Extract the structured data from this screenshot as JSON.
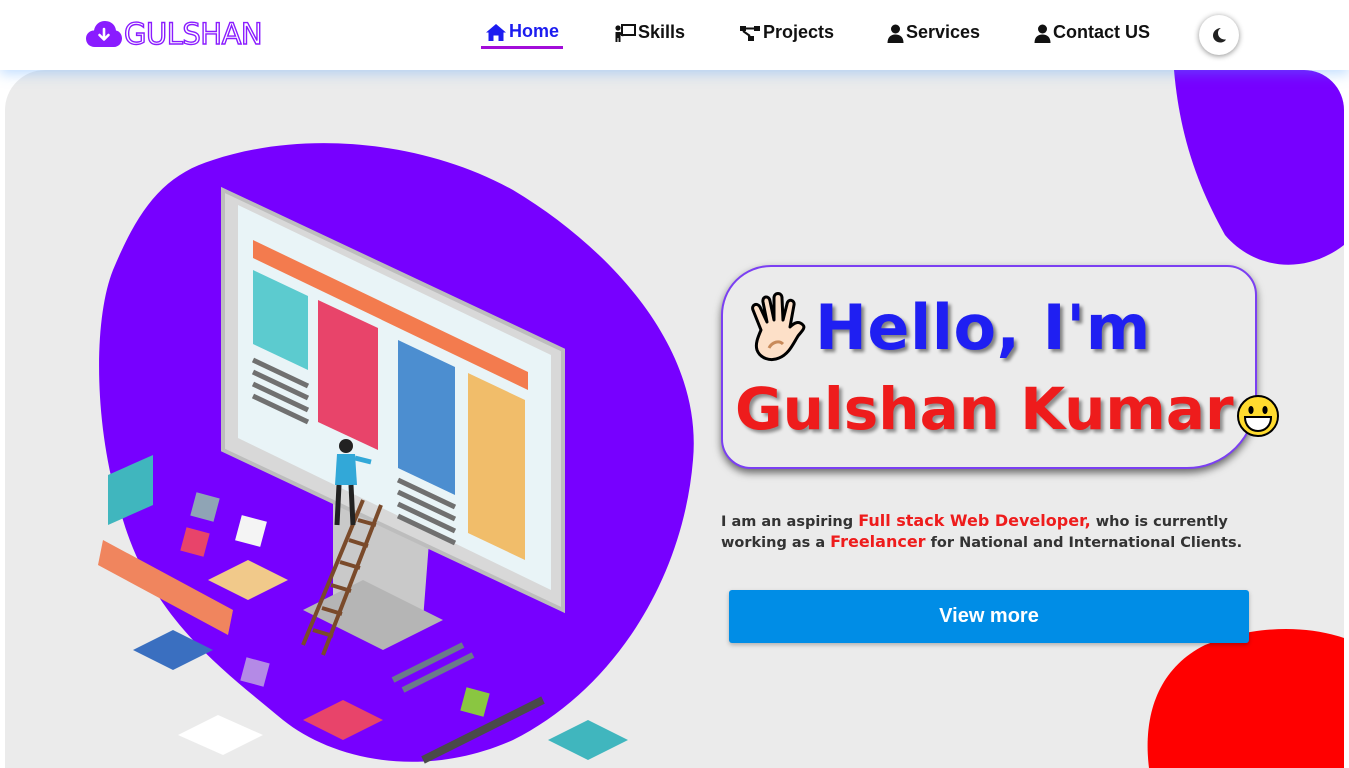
{
  "brand": {
    "logo_text": "GULSHAN",
    "logo_icon": "cloud-download-icon"
  },
  "nav": {
    "items": [
      {
        "label": "Home",
        "icon": "home-icon",
        "active": true
      },
      {
        "label": "Skills",
        "icon": "presenter-icon",
        "active": false
      },
      {
        "label": "Projects",
        "icon": "project-diagram-icon",
        "active": false
      },
      {
        "label": "Services",
        "icon": "user-icon",
        "active": false
      },
      {
        "label": "Contact US",
        "icon": "user-icon",
        "active": false
      }
    ],
    "theme_toggle_icon": "moon-icon"
  },
  "hero": {
    "greeting": "Hello, I'm",
    "name": "Gulshan Kumar",
    "intro_part1": "I am an aspiring ",
    "intro_highlight1": "Full stack Web Developer,",
    "intro_part2": " who is currently working as a ",
    "intro_highlight2": "Freelancer",
    "intro_part3": " for National and International Clients.",
    "cta_label": "View more",
    "illustration": "web-developer-isometric-illustration"
  },
  "colors": {
    "brand_purple": "#8a1cff",
    "active_blue": "#1c1cf0",
    "active_underline": "#a20dd9",
    "blob_purple": "#7700ff",
    "blob_red": "#ff0000",
    "hello_blue": "#1f1ff2",
    "name_red": "#ee1c1c",
    "button_blue": "#008de6",
    "hero_bg": "#ebebeb"
  }
}
